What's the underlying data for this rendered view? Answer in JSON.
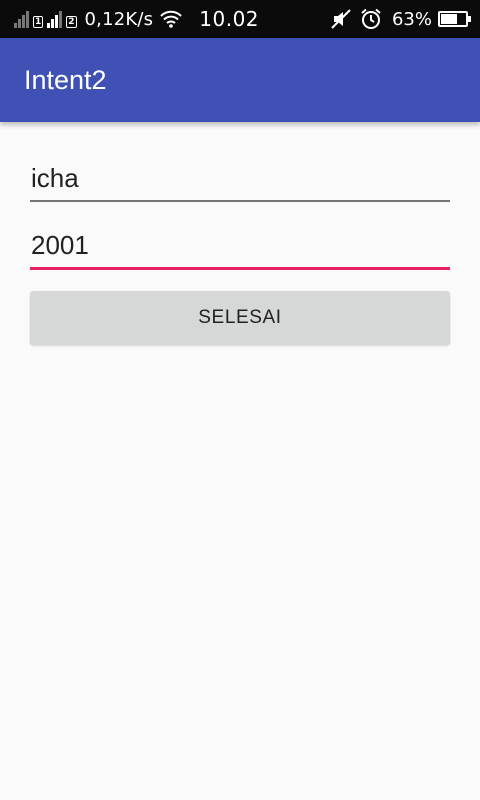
{
  "status_bar": {
    "sim1_label": "1",
    "sim2_label": "2",
    "network_speed": "0,12K/s",
    "time": "10.02",
    "battery_percent": "63%",
    "battery_level": 0.63,
    "icons": [
      "sim1-signal-icon",
      "sim2-signal-icon",
      "wifi-icon",
      "mute-icon",
      "alarm-icon",
      "battery-icon"
    ]
  },
  "app_bar": {
    "title": "Intent2",
    "color": "#3f51b5"
  },
  "form": {
    "name_value": "icha",
    "year_value": "2001",
    "focused_underline_color": "#e91e63",
    "submit_label": "SELESAI"
  }
}
